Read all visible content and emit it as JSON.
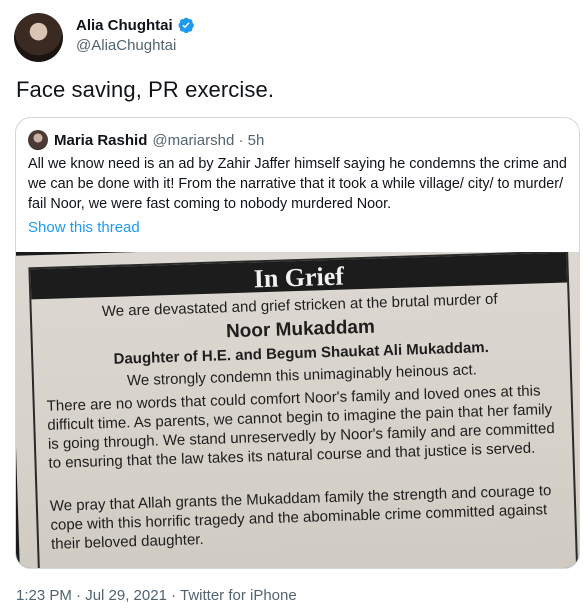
{
  "tweet": {
    "author_name": "Alia Chughtai",
    "author_handle": "@AliaChughtai",
    "text": "Face saving, PR exercise.",
    "timestamp": "1:23 PM · Jul 29, 2021 · Twitter for iPhone"
  },
  "quote": {
    "author_name": "Maria Rashid",
    "author_handle_time": "@mariarshd · 5h",
    "text": "All we know need is an ad by Zahir Jaffer himself saying he condemns the crime and we can be done with it! From the narrative that it took a while village/ city/ to murder/ fail Noor, we were fast coming to nobody murdered Noor.",
    "show_thread": "Show this thread"
  },
  "image": {
    "title": "In Grief",
    "line1": "We are devastated and grief stricken at the brutal murder of",
    "line2": "Noor Mukaddam",
    "line3": "Daughter of H.E. and Begum Shaukat Ali Mukaddam.",
    "line4": "We strongly condemn this unimaginably heinous act.",
    "para1": "There are no words that could comfort Noor's family and loved ones at this difficult time. As parents, we cannot begin to imagine the pain that her family is going through. We stand unreservedly by Noor's family and are committed to ensuring that the law takes its natural course and that justice is served.",
    "para2": "We pray that Allah grants the Mukaddam family the strength and courage to cope with this horrific tragedy and the abominable crime committed against their beloved daughter."
  },
  "colors": {
    "verified": "#1d9bf0",
    "link": "#1d9bf0",
    "secondary_text": "#536471"
  }
}
